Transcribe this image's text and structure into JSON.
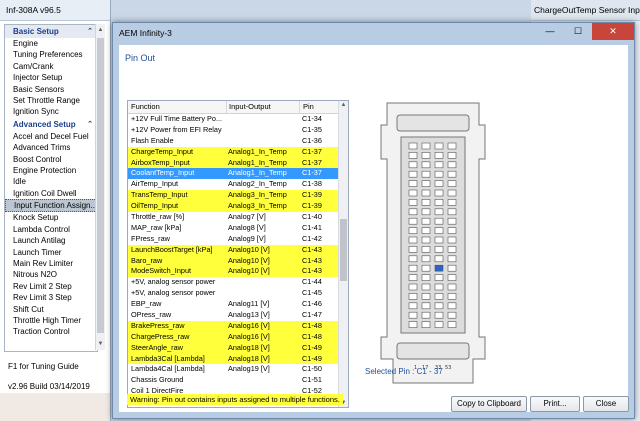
{
  "main_window": {
    "title": "Inf-308A v96.5",
    "sections": [
      {
        "label": "Basic Setup",
        "items": [
          "Engine",
          "Tuning Preferences",
          "Cam/Crank",
          "Injector Setup",
          "Basic Sensors",
          "Set Throttle Range",
          "Ignition Sync"
        ]
      },
      {
        "label": "Advanced Setup",
        "items": [
          "Accel and Decel Fuel",
          "Advanced Trims",
          "Boost Control",
          "Engine Protection",
          "Idle",
          "Ignition Coil Dwell",
          "Input Function Assign...",
          "Knock Setup",
          "Lambda Control",
          "Launch Antilag",
          "Launch Timer",
          "Main Rev Limiter",
          "Nitrous N2O",
          "Rev Limit 2 Step",
          "Rev Limit 3 Step",
          "Shift Cut",
          "Throttle High Timer",
          "Traction Control"
        ]
      }
    ],
    "selected_item": "Input Function Assign...",
    "help_text": "F1 for Tuning Guide",
    "build": "v2.96 Build 03/14/2019"
  },
  "right_window": {
    "title": "ChargeOutTemp Sensor Input"
  },
  "dialog": {
    "title": "AEM Infinity-3",
    "window_controls": {
      "minimize": "—",
      "maximize": "☐",
      "close": "✕"
    },
    "heading": "Pin Out",
    "columns": [
      "Function",
      "Input-Output",
      "Pin"
    ],
    "rows": [
      {
        "function": "+12V Full Time Battery Po...",
        "io": "",
        "pin": "C1-34",
        "state": "normal"
      },
      {
        "function": "+12V Power from EFI Relay",
        "io": "",
        "pin": "C1-35",
        "state": "normal"
      },
      {
        "function": "Flash Enable",
        "io": "",
        "pin": "C1-36",
        "state": "normal"
      },
      {
        "function": "ChargeTemp_Input",
        "io": "Analog1_In_Temp",
        "pin": "C1-37",
        "state": "highlight"
      },
      {
        "function": "AirboxTemp_Input",
        "io": "Analog1_In_Temp",
        "pin": "C1-37",
        "state": "highlight"
      },
      {
        "function": "CoolantTemp_Input",
        "io": "Analog1_In_Temp",
        "pin": "C1-37",
        "state": "selected"
      },
      {
        "function": "AirTemp_Input",
        "io": "Analog2_In_Temp",
        "pin": "C1-38",
        "state": "normal"
      },
      {
        "function": "TransTemp_Input",
        "io": "Analog3_In_Temp",
        "pin": "C1-39",
        "state": "highlight"
      },
      {
        "function": "OilTemp_Input",
        "io": "Analog3_In_Temp",
        "pin": "C1-39",
        "state": "highlight"
      },
      {
        "function": "Throttle_raw [%]",
        "io": "Analog7 [V]",
        "pin": "C1-40",
        "state": "normal"
      },
      {
        "function": "MAP_raw [kPa]",
        "io": "Analog8 [V]",
        "pin": "C1-41",
        "state": "normal"
      },
      {
        "function": "FPress_raw",
        "io": "Analog9 [V]",
        "pin": "C1-42",
        "state": "normal"
      },
      {
        "function": "LaunchBoostTarget [kPa]",
        "io": "Analog10 [V]",
        "pin": "C1-43",
        "state": "highlight"
      },
      {
        "function": "Baro_raw",
        "io": "Analog10 [V]",
        "pin": "C1-43",
        "state": "highlight"
      },
      {
        "function": "ModeSwitch_Input",
        "io": "Analog10 [V]",
        "pin": "C1-43",
        "state": "highlight"
      },
      {
        "function": "+5V, analog sensor power",
        "io": "",
        "pin": "C1-44",
        "state": "normal"
      },
      {
        "function": "+5V, analog sensor power",
        "io": "",
        "pin": "C1-45",
        "state": "normal"
      },
      {
        "function": "EBP_raw",
        "io": "Analog11 [V]",
        "pin": "C1-46",
        "state": "normal"
      },
      {
        "function": "OPress_raw",
        "io": "Analog13 [V]",
        "pin": "C1-47",
        "state": "normal"
      },
      {
        "function": "BrakePress_raw",
        "io": "Analog16 [V]",
        "pin": "C1-48",
        "state": "highlight"
      },
      {
        "function": "ChargePress_raw",
        "io": "Analog16 [V]",
        "pin": "C1-48",
        "state": "highlight"
      },
      {
        "function": "SteerAngle_raw",
        "io": "Analog18 [V]",
        "pin": "C1-49",
        "state": "highlight"
      },
      {
        "function": "Lambda3Cal [Lambda]",
        "io": "Analog18 [V]",
        "pin": "C1-49",
        "state": "highlight"
      },
      {
        "function": "Lambda4Cal [Lambda]",
        "io": "Analog19 [V]",
        "pin": "C1-50",
        "state": "normal"
      },
      {
        "function": "Chassis Ground",
        "io": "",
        "pin": "C1-51",
        "state": "normal"
      },
      {
        "function": "Coil 1 DirectFire",
        "io": "",
        "pin": "C1-52",
        "state": "normal"
      }
    ],
    "connector": {
      "pin_labels": [
        "1",
        "17",
        "33",
        "53"
      ],
      "selected_pin_text": "Selected Pin : C1 - 37"
    },
    "warning": "Warning: Pin out contains inputs assigned to multiple functions.",
    "buttons": {
      "copy": "Copy to Clipboard",
      "print": "Print...",
      "close": "Close"
    },
    "colors": {
      "highlight": "#ffff3b",
      "selected": "#3399ff",
      "accent": "#1f4d9b"
    }
  }
}
